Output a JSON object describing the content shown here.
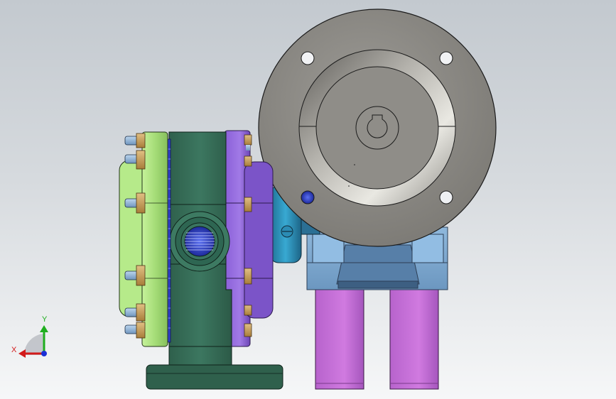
{
  "triad": {
    "x_label": "X",
    "y_label": "Y",
    "x_color": "#d21a1a",
    "y_color": "#1fae1f",
    "z_color": "#1b2fd6"
  },
  "colors": {
    "background_top": "#c3c9cf",
    "background_bottom": "#f6f7f8",
    "motor_flange": "#8c8a85",
    "pump_body": "#356b56",
    "front_cover": "#a9e07d",
    "side_plate": "#9a6fe0",
    "coupling": "#2a8eb5",
    "mount_bracket": "#7fa9cf",
    "feet": "#c370d6",
    "bolts": "#c8a05a"
  }
}
